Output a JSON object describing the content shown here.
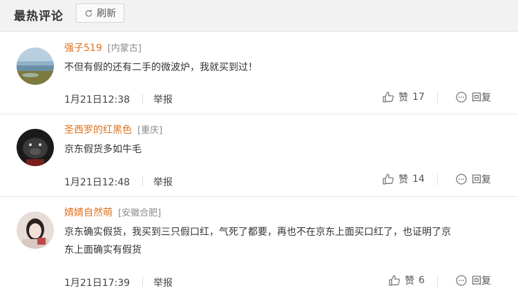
{
  "header": {
    "title": "最热评论",
    "refresh_label": "刷新"
  },
  "comments": [
    {
      "username": "强子519",
      "location": "[内蒙古]",
      "lines": [
        "不但有假的还有二手的微波炉，我就买到过！"
      ],
      "time": "1月21日12:38",
      "report_label": "举报",
      "like_label": "赞",
      "like_count": "17",
      "reply_label": "回复"
    },
    {
      "username": "圣西罗的红黑色",
      "location": "[重庆]",
      "lines": [
        "京东假货多如牛毛"
      ],
      "time": "1月21日12:48",
      "report_label": "举报",
      "like_label": "赞",
      "like_count": "14",
      "reply_label": "回复"
    },
    {
      "username": "婧婧自然萌",
      "location": "[安徽合肥]",
      "lines": [
        "京东确实假货，我买到三只假口红，气死了都要，再也不在京东上面买口红了，也证明了京",
        "东上面确实有假货"
      ],
      "time": "1月21日17:39",
      "report_label": "举报",
      "like_label": "赞",
      "like_count": "6",
      "reply_label": "回复"
    }
  ]
}
